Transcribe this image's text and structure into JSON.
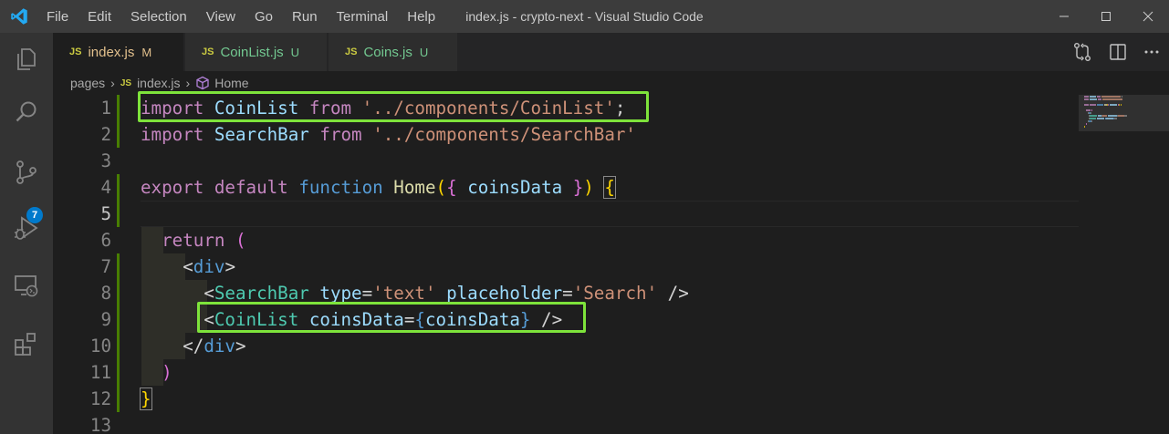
{
  "window": {
    "title": "index.js - crypto-next - Visual Studio Code",
    "menu": [
      "File",
      "Edit",
      "Selection",
      "View",
      "Go",
      "Run",
      "Terminal",
      "Help"
    ]
  },
  "activity_bar": {
    "items": [
      "explorer-icon",
      "search-icon",
      "source-control-icon",
      "run-debug-icon",
      "remote-explorer-icon",
      "extensions-icon"
    ],
    "source_control_badge": "7"
  },
  "tabs": [
    {
      "badge": "JS",
      "label": "index.js",
      "status": "M",
      "active": true
    },
    {
      "badge": "JS",
      "label": "CoinList.js",
      "status": "U",
      "active": false
    },
    {
      "badge": "JS",
      "label": "Coins.js",
      "status": "U",
      "active": false
    }
  ],
  "breadcrumb": {
    "folder": "pages",
    "file_badge": "JS",
    "file": "index.js",
    "symbol": "Home"
  },
  "editor": {
    "line_numbers": [
      "1",
      "2",
      "3",
      "4",
      "5",
      "6",
      "7",
      "8",
      "9",
      "10",
      "11",
      "12",
      "13"
    ],
    "current_line": 5,
    "lines": [
      [
        [
          "kw",
          "import"
        ],
        [
          "txt",
          " "
        ],
        [
          "id",
          "CoinList"
        ],
        [
          "txt",
          " "
        ],
        [
          "kw",
          "from"
        ],
        [
          "txt",
          " "
        ],
        [
          "str",
          "'../components/CoinList'"
        ],
        [
          "txt",
          ";"
        ]
      ],
      [
        [
          "kw",
          "import"
        ],
        [
          "txt",
          " "
        ],
        [
          "id",
          "SearchBar"
        ],
        [
          "txt",
          " "
        ],
        [
          "kw",
          "from"
        ],
        [
          "txt",
          " "
        ],
        [
          "str",
          "'../components/SearchBar'"
        ]
      ],
      [],
      [
        [
          "kw",
          "export"
        ],
        [
          "txt",
          " "
        ],
        [
          "kw",
          "default"
        ],
        [
          "txt",
          " "
        ],
        [
          "st",
          "function"
        ],
        [
          "txt",
          " "
        ],
        [
          "fn",
          "Home"
        ],
        [
          "br1",
          "("
        ],
        [
          "br2",
          "{"
        ],
        [
          "txt",
          " "
        ],
        [
          "id",
          "coinsData"
        ],
        [
          "txt",
          " "
        ],
        [
          "br2",
          "}"
        ],
        [
          "br1",
          ")"
        ],
        [
          "txt",
          " "
        ],
        [
          "br1",
          "{"
        ]
      ],
      [],
      [
        [
          "txt",
          "  "
        ],
        [
          "kw",
          "return"
        ],
        [
          "txt",
          " "
        ],
        [
          "br2",
          "("
        ]
      ],
      [
        [
          "txt",
          "    "
        ],
        [
          "txt",
          "<"
        ],
        [
          "st",
          "div"
        ],
        [
          "txt",
          ">"
        ]
      ],
      [
        [
          "txt",
          "      "
        ],
        [
          "txt",
          "<"
        ],
        [
          "tag",
          "SearchBar"
        ],
        [
          "txt",
          " "
        ],
        [
          "id",
          "type"
        ],
        [
          "txt",
          "="
        ],
        [
          "str",
          "'text'"
        ],
        [
          "txt",
          " "
        ],
        [
          "id",
          "placeholder"
        ],
        [
          "txt",
          "="
        ],
        [
          "str",
          "'Search'"
        ],
        [
          "txt",
          " />"
        ]
      ],
      [
        [
          "txt",
          "      "
        ],
        [
          "txt",
          "<"
        ],
        [
          "tag",
          "CoinList"
        ],
        [
          "txt",
          " "
        ],
        [
          "id",
          "coinsData"
        ],
        [
          "txt",
          "="
        ],
        [
          "st",
          "{"
        ],
        [
          "id",
          "coinsData"
        ],
        [
          "st",
          "}"
        ],
        [
          "txt",
          " />"
        ]
      ],
      [
        [
          "txt",
          "    "
        ],
        [
          "txt",
          "</"
        ],
        [
          "st",
          "div"
        ],
        [
          "txt",
          ">"
        ]
      ],
      [
        [
          "txt",
          "  "
        ],
        [
          "br2",
          ")"
        ]
      ],
      [
        [
          "br1",
          "}"
        ]
      ],
      []
    ]
  },
  "colors": {
    "highlight_box": "#7ee33b",
    "badge": "#007acc",
    "modified_git": "#e2c08d",
    "untracked_git": "#73c991"
  }
}
